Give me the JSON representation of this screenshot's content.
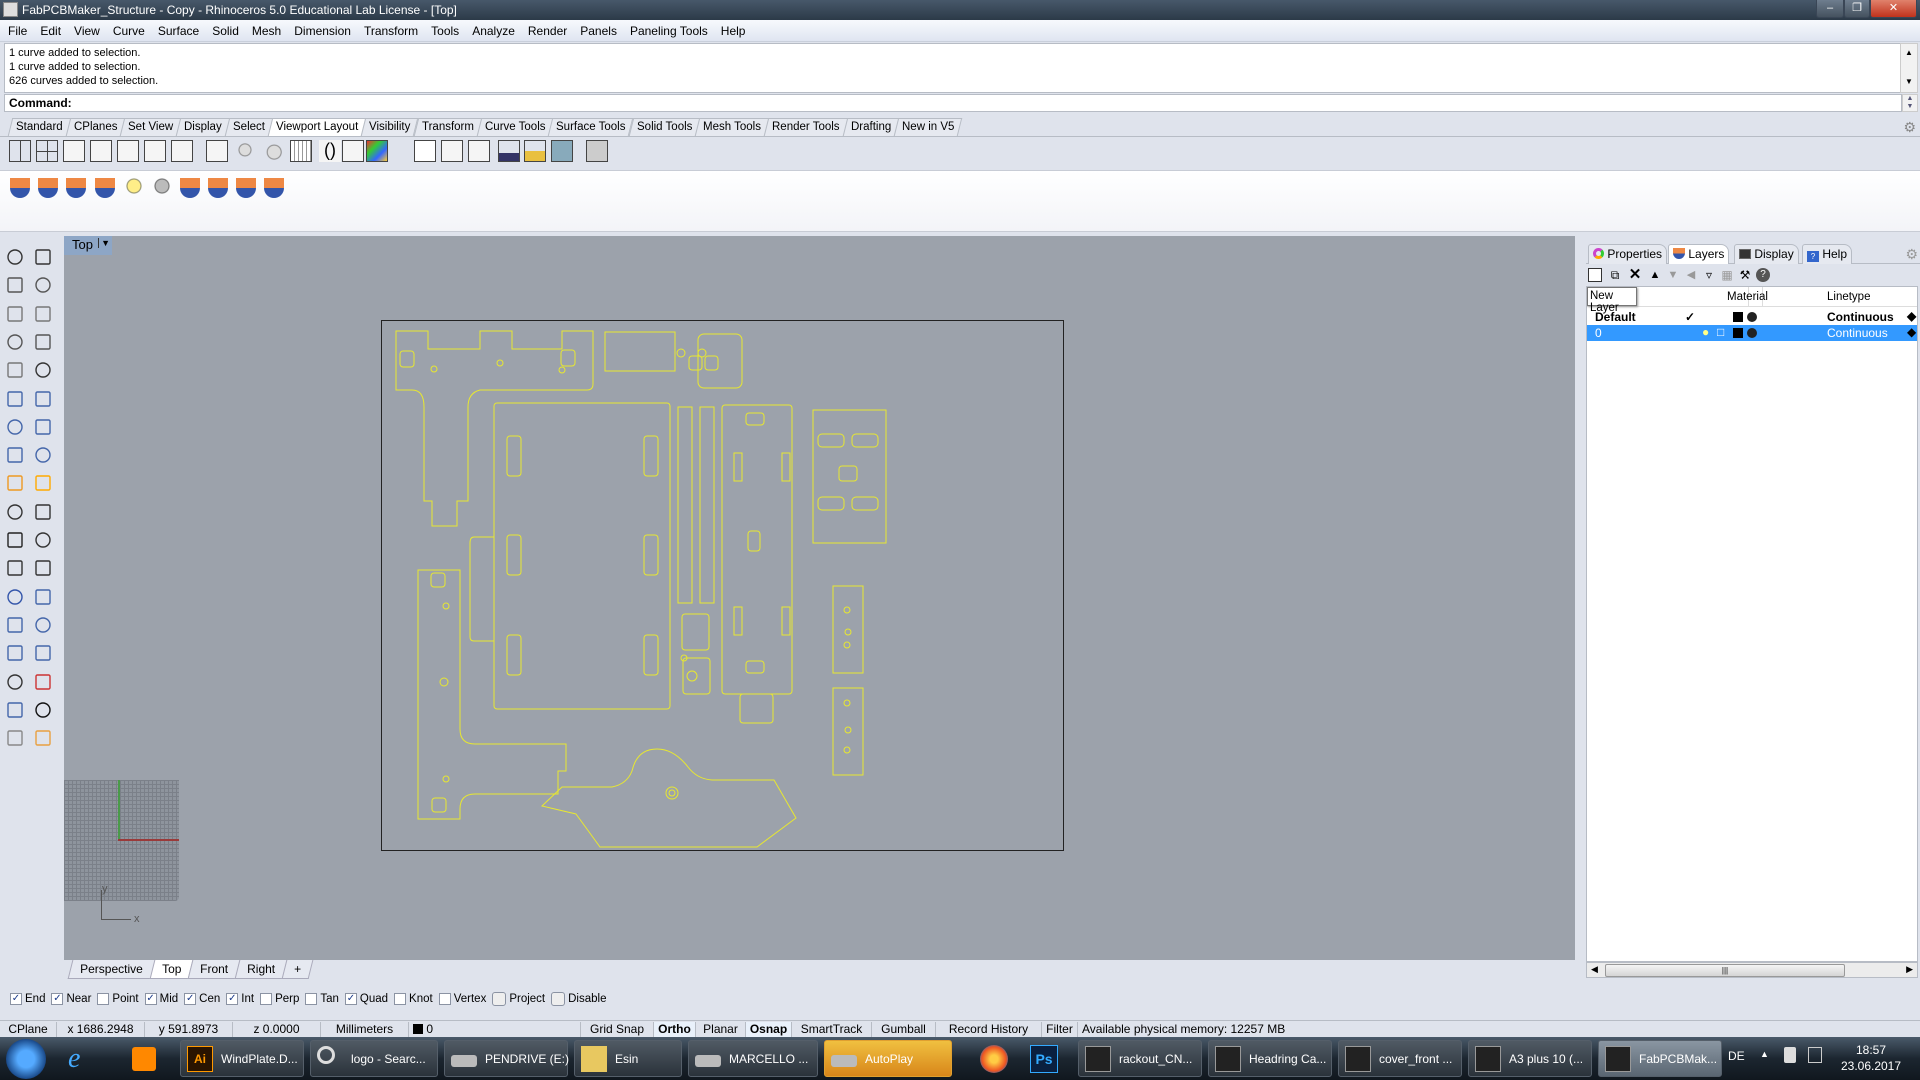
{
  "window": {
    "title": "FabPCBMaker_Structure - Copy - Rhinoceros 5.0 Educational Lab License - [Top]",
    "controls": [
      "minimize",
      "restore",
      "close"
    ]
  },
  "menu": [
    "File",
    "Edit",
    "View",
    "Curve",
    "Surface",
    "Solid",
    "Mesh",
    "Dimension",
    "Transform",
    "Tools",
    "Analyze",
    "Render",
    "Panels",
    "Paneling Tools",
    "Help"
  ],
  "command": {
    "history": [
      "1 curve added to selection.",
      "1 curve added to selection.",
      "626 curves added to selection."
    ],
    "prompt": "Command:"
  },
  "toolbar_tabs": {
    "items": [
      "Standard",
      "CPlanes",
      "Set View",
      "Display",
      "Select",
      "Viewport Layout",
      "Visibility",
      "Transform",
      "Curve Tools",
      "Surface Tools",
      "Solid Tools",
      "Mesh Tools",
      "Render Tools",
      "Drafting",
      "New in V5"
    ],
    "active": "Viewport Layout"
  },
  "toolbar_icons": [
    "4-viewports-icon",
    "4-viewports-equal-icon",
    "single-viewport-icon",
    "new-viewport-icon",
    "new-floating-viewport-icon",
    "split-horizontal-icon",
    "split-vertical-icon",
    "grid-options-icon",
    "light-icon",
    "camera-target-icon",
    "grid-icon",
    "lens-length-icon",
    "viewport-properties-icon",
    "background-bitmap-icon",
    "layout-icon",
    "layout-split-icon",
    "layout-detail-icon",
    "capture-to-file-icon",
    "open-layout-icon",
    "zoom-detail-icon",
    "print-icon"
  ],
  "layer_tools_row": [
    "layer-new-icon",
    "layer-rotate-icon",
    "layer-back-icon",
    "layer-selected-icon",
    "layer-light-icon",
    "layer-person-icon",
    "layer-state-icon",
    "layer-copy-icon",
    "layer-history-icon",
    "layer-import-icon"
  ],
  "left_tools": [
    "select-arrow-icon",
    "point-icon",
    "polyline-icon",
    "curve-icon",
    "circle-icon",
    "ellipse-icon",
    "arc-icon",
    "rectangle-icon",
    "polygon-icon",
    "fillet-curve-icon",
    "surface-corner-icon",
    "extrude-surface-icon",
    "box-icon",
    "sphere-icon",
    "cylinder-icon",
    "mesh-icon",
    "boolean-icon",
    "explode-icon",
    "trim-icon",
    "split-icon",
    "group-icon",
    "ungroup-icon",
    "offset-icon",
    "blend-icon",
    "text-icon",
    "scale-icon",
    "array-icon",
    "orient-icon",
    "solid-cap-icon",
    "extrude-icon",
    "grid-array-icon",
    "align-icon",
    "layer-icon",
    "check-icon",
    "render-icon",
    "light-icon"
  ],
  "viewport": {
    "name": "Top",
    "tabs": [
      "Perspective",
      "Top",
      "Front",
      "Right"
    ],
    "active_tab": "Top",
    "axis_labels": {
      "x": "x",
      "y": "y"
    },
    "curve_color": "#e8e830",
    "background": "#9ca2ab"
  },
  "panel": {
    "tabs": [
      "Properties",
      "Layers",
      "Display",
      "Help"
    ],
    "active_tab": "Layers",
    "tooltip": "New Layer",
    "columns": [
      "",
      "",
      "",
      "",
      "Material",
      "Linetype"
    ],
    "layers": [
      {
        "name": "Default",
        "current": "✓",
        "linetype": "Continuous",
        "selected": false
      },
      {
        "name": "0",
        "current": "",
        "linetype": "Continuous",
        "selected": true
      }
    ]
  },
  "osnap": [
    {
      "label": "End",
      "checked": true
    },
    {
      "label": "Near",
      "checked": true
    },
    {
      "label": "Point",
      "checked": false
    },
    {
      "label": "Mid",
      "checked": true
    },
    {
      "label": "Cen",
      "checked": true
    },
    {
      "label": "Int",
      "checked": true
    },
    {
      "label": "Perp",
      "checked": false
    },
    {
      "label": "Tan",
      "checked": false
    },
    {
      "label": "Quad",
      "checked": true
    },
    {
      "label": "Knot",
      "checked": false
    },
    {
      "label": "Vertex",
      "checked": false
    },
    {
      "label": "Project",
      "checked": false
    },
    {
      "label": "Disable",
      "checked": false
    }
  ],
  "status": {
    "cplane": "CPlane",
    "x": "x 1686.2948",
    "y": "y 591.8973",
    "z": "z 0.0000",
    "units": "Millimeters",
    "layer": "0",
    "grid_snap": "Grid Snap",
    "ortho": "Ortho",
    "planar": "Planar",
    "osnap": "Osnap",
    "smarttrack": "SmartTrack",
    "gumball": "Gumball",
    "record_history": "Record History",
    "filter": "Filter",
    "memory": "Available physical memory: 12257 MB"
  },
  "taskbar": {
    "items": [
      {
        "label": "WindPlate.D...",
        "icon": "illustrator-icon"
      },
      {
        "label": "logo - Searc...",
        "icon": "search-icon"
      },
      {
        "label": "PENDRIVE (E:)",
        "icon": "drive-icon"
      },
      {
        "label": "Esin",
        "icon": "folder-icon"
      },
      {
        "label": "MARCELLO ...",
        "icon": "drive-icon"
      },
      {
        "label": "AutoPlay",
        "icon": "drive-icon"
      },
      {
        "label": "rackout_CN...",
        "icon": "rhino-icon"
      },
      {
        "label": "Headring Ca...",
        "icon": "rhino-icon"
      },
      {
        "label": "cover_front ...",
        "icon": "rhino-icon"
      },
      {
        "label": "A3 plus 10 (...",
        "icon": "rhino-icon"
      },
      {
        "label": "FabPCBMak...",
        "icon": "rhino-icon"
      }
    ],
    "language": "DE",
    "time": "18:57",
    "date": "23.06.2017"
  }
}
